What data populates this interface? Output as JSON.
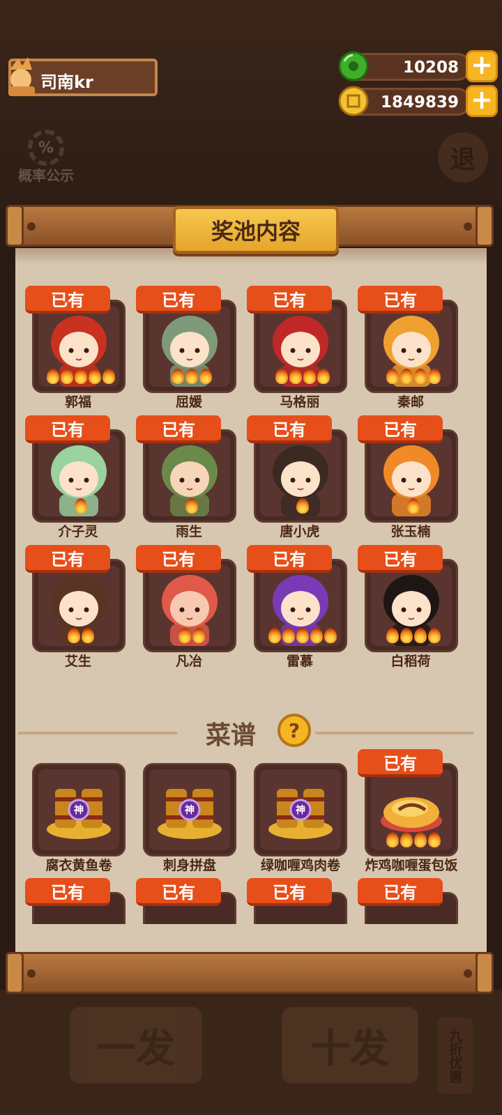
{
  "profile": {
    "name": "司南kr"
  },
  "currency": [
    {
      "icon": "jade-coin-icon",
      "value": "10208"
    },
    {
      "icon": "gold-coin-icon",
      "value": "1849839"
    }
  ],
  "plus_label": "+",
  "probability": {
    "icon_text": "%",
    "label": "概率公示"
  },
  "exit_label": "退",
  "panel": {
    "title": "奖池内容",
    "owned_label": "已有"
  },
  "characters": [
    {
      "name": "郭福",
      "owned": true,
      "flames": 5,
      "hair": "#c8321e",
      "skin": "#fbe2c8"
    },
    {
      "name": "屈媛",
      "owned": true,
      "flames": 3,
      "hair": "#7f9a78",
      "skin": "#fbe2c8"
    },
    {
      "name": "马格丽",
      "owned": true,
      "flames": 4,
      "hair": "#c02828",
      "skin": "#fbe2c8"
    },
    {
      "name": "秦邮",
      "owned": true,
      "flames": 4,
      "hair": "#f0a030",
      "skin": "#fbe2c8"
    },
    {
      "name": "介子灵",
      "owned": true,
      "flames": 1,
      "hair": "#9ad2a0",
      "skin": "#fbe2c8"
    },
    {
      "name": "雨生",
      "owned": true,
      "flames": 1,
      "hair": "#6b8a4a",
      "skin": "#f6d6b8"
    },
    {
      "name": "唐小虎",
      "owned": true,
      "flames": 1,
      "hair": "#3a2a22",
      "skin": "#fbe2c8"
    },
    {
      "name": "张玉楠",
      "owned": true,
      "flames": 1,
      "hair": "#f08a28",
      "skin": "#fbe2c8"
    },
    {
      "name": "艾生",
      "owned": true,
      "flames": 2,
      "hair": "#5a3422",
      "skin": "#fbe2c8"
    },
    {
      "name": "凡冶",
      "owned": true,
      "flames": 2,
      "hair": "#e05a4a",
      "skin": "#f8c8b0"
    },
    {
      "name": "雷慕",
      "owned": true,
      "flames": 5,
      "hair": "#7a3ab8",
      "skin": "#fbe2c8"
    },
    {
      "name": "白稻荷",
      "owned": true,
      "flames": 4,
      "hair": "#1e1614",
      "skin": "#fbe2c8"
    }
  ],
  "recipe_section": {
    "title": "菜谱",
    "help_icon": "question-icon",
    "help_text": "?"
  },
  "recipes": [
    {
      "name": "腐衣黄鱼卷",
      "owned": false,
      "badge_text": "神",
      "flames": 0
    },
    {
      "name": "刺身拼盘",
      "owned": false,
      "badge_text": "神",
      "flames": 0
    },
    {
      "name": "绿咖喱鸡肉卷",
      "owned": false,
      "badge_text": "神",
      "flames": 0
    },
    {
      "name": "炸鸡咖喱蛋包饭",
      "owned": true,
      "badge_text": "",
      "flames": 4
    }
  ],
  "partial_row_count": 4,
  "background_buttons": {
    "single": "一发",
    "ten": "十发",
    "side": "九折优惠"
  }
}
